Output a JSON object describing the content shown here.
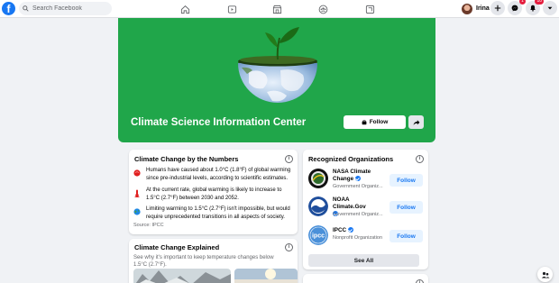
{
  "topbar": {
    "logo_letter": "f",
    "search_placeholder": "Search Facebook",
    "nav_icons": [
      "home-icon",
      "watch-icon",
      "marketplace-icon",
      "groups-icon",
      "gaming-icon"
    ],
    "profile_name": "Irina",
    "messenger_badge": "1",
    "notifications_badge": "10"
  },
  "hero": {
    "title": "Climate Science Information Center",
    "follow_label": "Follow",
    "background_color": "#20a64a"
  },
  "numbers_card": {
    "title": "Climate Change by the Numbers",
    "facts": [
      {
        "icon": "globe-warming-icon",
        "text": "Humans have caused about 1.0°C (1.8°F) of global warming since pre-industrial levels, according to scientific estimates."
      },
      {
        "icon": "thermometer-icon",
        "text": "At the current rate, global warming is likely to increase to 1.5°C (2.7°F) between 2030 and 2052."
      },
      {
        "icon": "earth-icon",
        "text": "Limiting warming to 1.5°C (2.7°F) isn't impossible, but would require unprecedented transitions in all aspects of society."
      }
    ],
    "source": "Source: IPCC"
  },
  "orgs_card": {
    "title": "Recognized Organizations",
    "orgs": [
      {
        "name": "NASA Climate Change",
        "sub": "Government Organiz...",
        "follow_label": "Follow"
      },
      {
        "name": "NOAA Climate.Gov",
        "sub": "Government Organiz...",
        "follow_label": "Follow"
      },
      {
        "name": "IPCC",
        "sub": "Nonprofit Organization",
        "follow_label": "Follow"
      }
    ],
    "see_all_label": "See All"
  },
  "explained_card": {
    "title": "Climate Change Explained",
    "subtitle": "See why it's important to keep temperature changes below 1.5°C (2.7°F)."
  },
  "colors": {
    "brand_blue": "#1877f2",
    "page_bg": "#f0f2f5"
  }
}
